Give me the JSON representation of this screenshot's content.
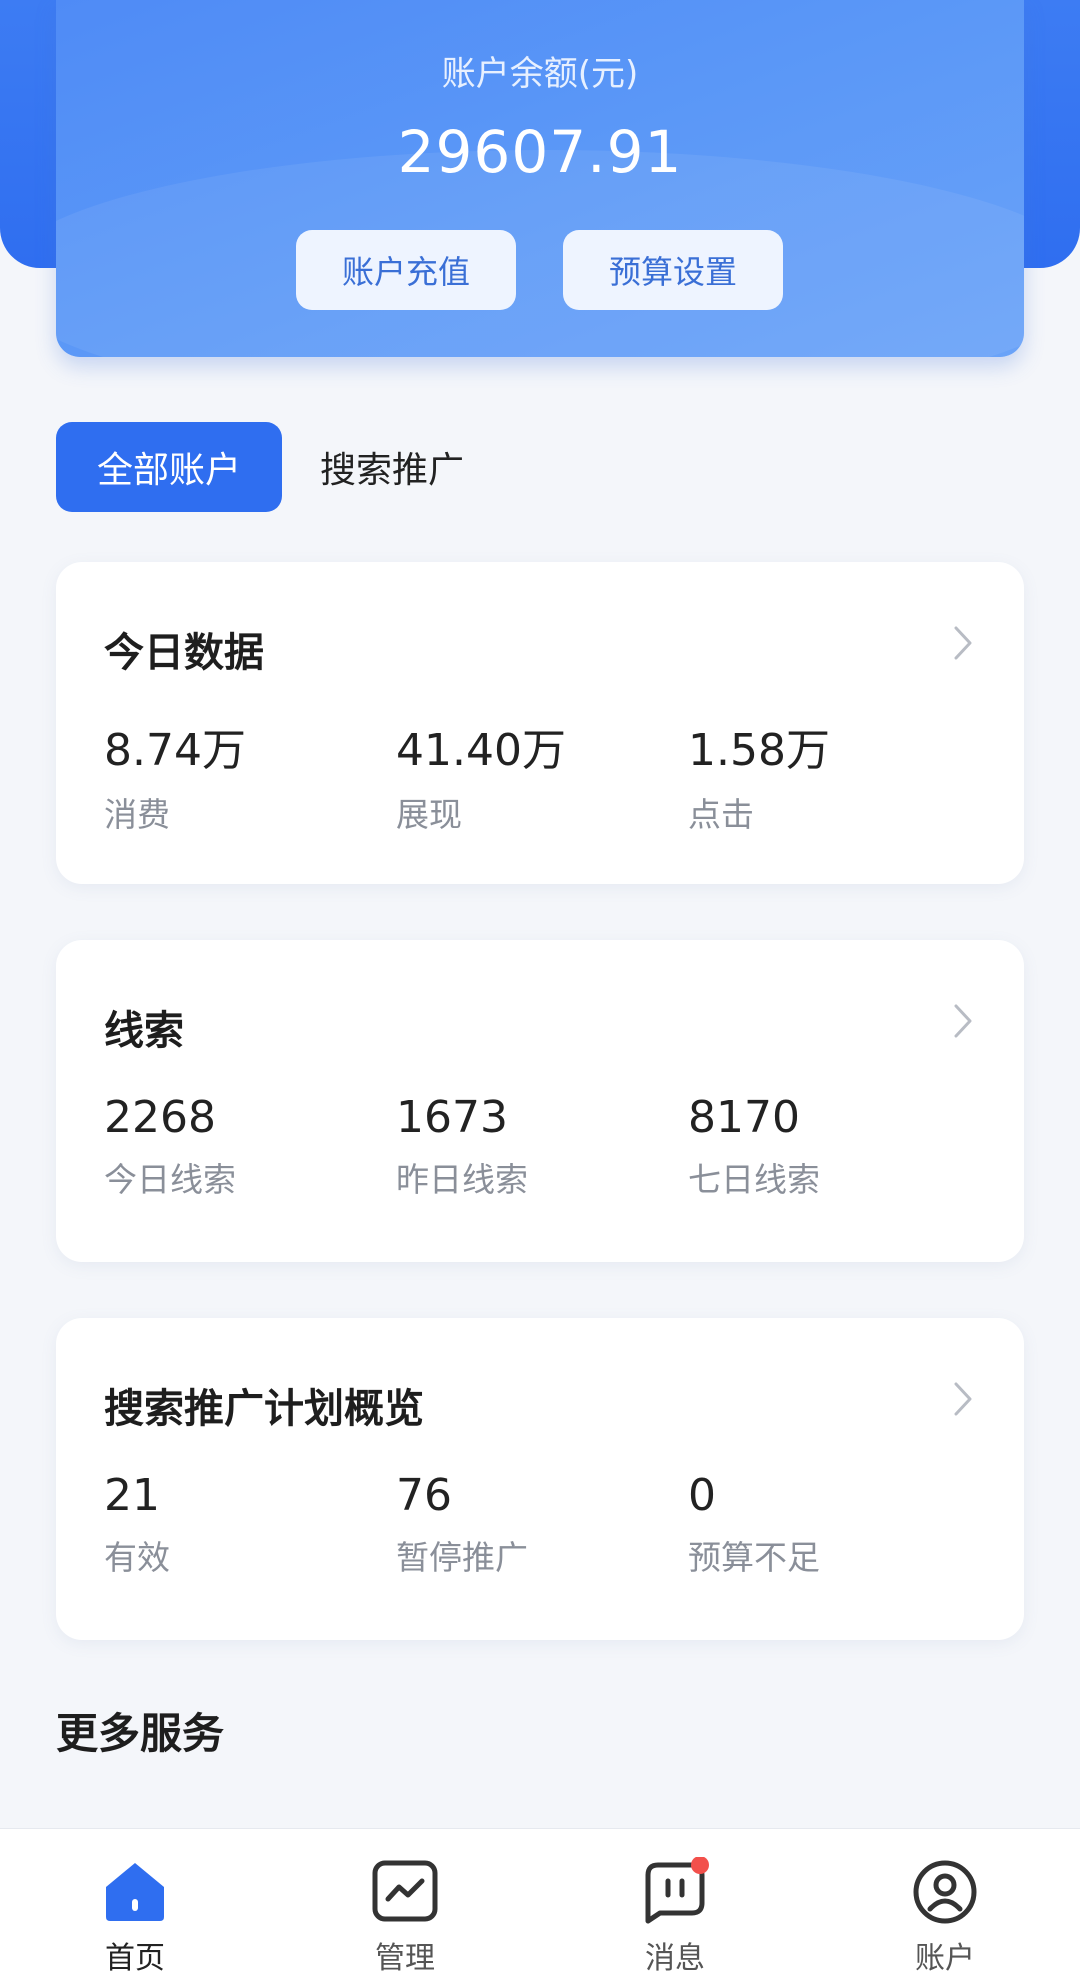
{
  "header": {
    "balance_label": "账户余额(元)",
    "balance_value": "29607.91",
    "recharge_label": "账户充值",
    "budget_label": "预算设置"
  },
  "tabs": [
    {
      "label": "全部账户",
      "active": true
    },
    {
      "label": "搜索推广",
      "active": false
    }
  ],
  "today": {
    "title": "今日数据",
    "metrics": [
      {
        "value": "8.74万",
        "label": "消费"
      },
      {
        "value": "41.40万",
        "label": "展现"
      },
      {
        "value": "1.58万",
        "label": "点击"
      }
    ]
  },
  "clues": {
    "title": "线索",
    "metrics": [
      {
        "value": "2268",
        "label": "今日线索"
      },
      {
        "value": "1673",
        "label": "昨日线索"
      },
      {
        "value": "8170",
        "label": "七日线索"
      }
    ]
  },
  "plans": {
    "title": "搜索推广计划概览",
    "metrics": [
      {
        "value": "21",
        "label": "有效"
      },
      {
        "value": "76",
        "label": "暂停推广"
      },
      {
        "value": "0",
        "label": "预算不足"
      }
    ]
  },
  "more_services": "更多服务",
  "bottom_nav": [
    {
      "label": "首页",
      "icon": "home-icon",
      "active": true
    },
    {
      "label": "管理",
      "icon": "chart-icon",
      "active": false
    },
    {
      "label": "消息",
      "icon": "message-icon",
      "active": false,
      "badge": true
    },
    {
      "label": "账户",
      "icon": "user-icon",
      "active": false
    }
  ],
  "colors": {
    "primary": "#2f6ef0",
    "badge": "#f2504b",
    "muted_text": "#8a8f99"
  }
}
